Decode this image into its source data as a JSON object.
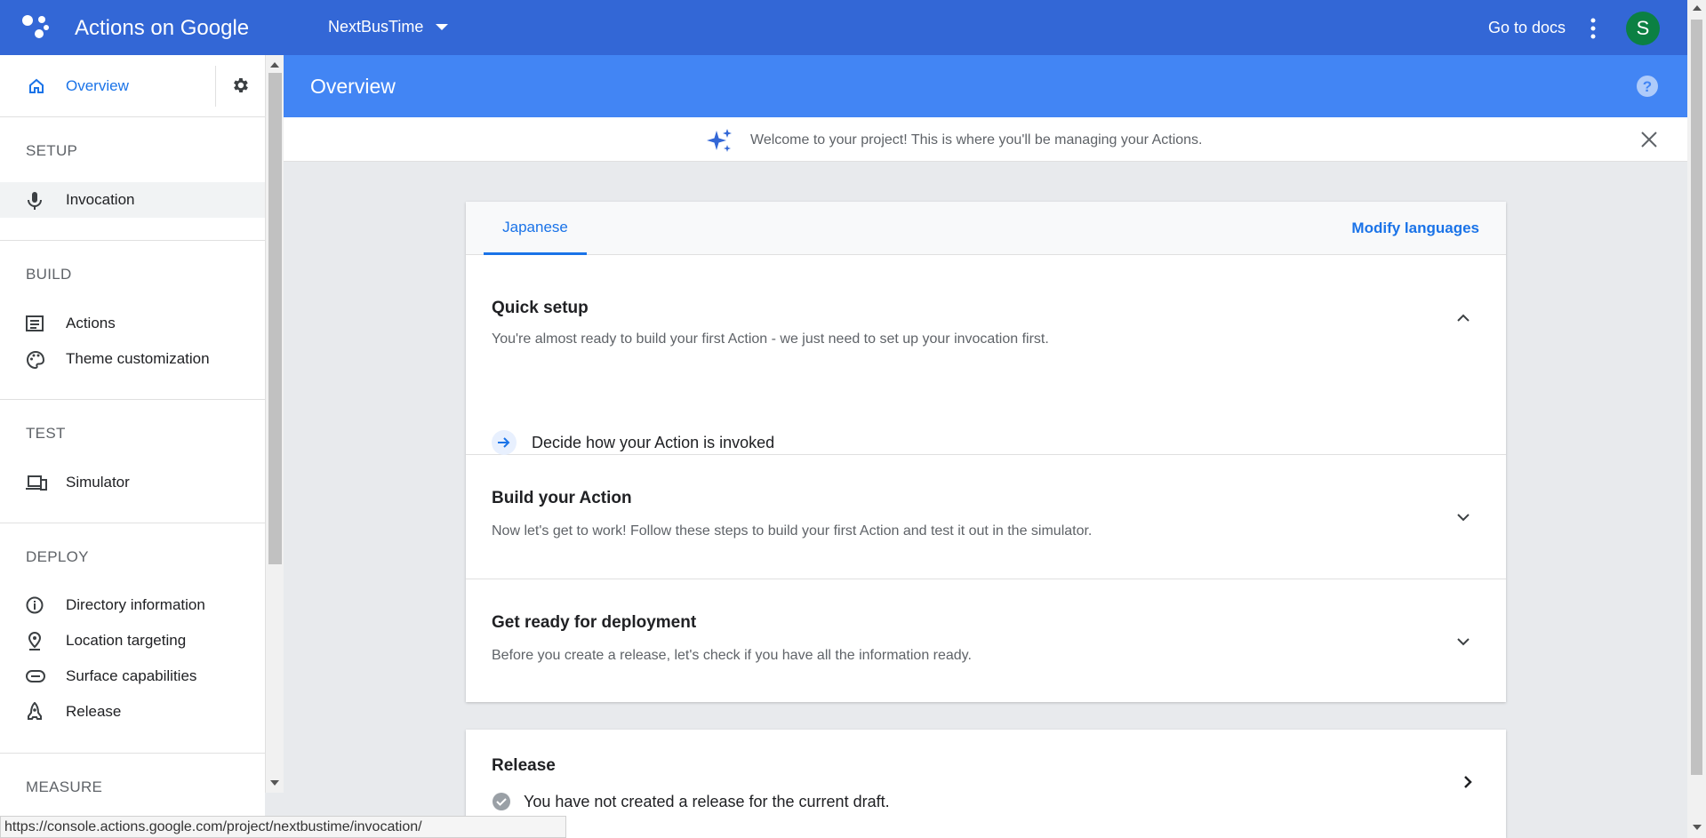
{
  "topbar": {
    "app_title": "Actions on Google",
    "project_name": "NextBusTime",
    "docs_label": "Go to docs",
    "avatar_initial": "S",
    "bar_color": "#3367d6",
    "avatar_color": "#0b8043"
  },
  "sidebar": {
    "overview_label": "Overview",
    "sections": {
      "setup": "SETUP",
      "build": "BUILD",
      "test": "TEST",
      "deploy": "DEPLOY",
      "measure": "MEASURE"
    },
    "items": {
      "invocation": "Invocation",
      "actions": "Actions",
      "theme": "Theme customization",
      "simulator": "Simulator",
      "directory": "Directory information",
      "location": "Location targeting",
      "surface": "Surface capabilities",
      "release": "Release"
    },
    "icons": [
      "home-icon",
      "gear-icon",
      "mic-icon",
      "list-icon",
      "palette-icon",
      "devices-icon",
      "info-icon",
      "location-pin-icon",
      "surface-icon",
      "rocket-icon"
    ]
  },
  "main": {
    "page_title": "Overview",
    "welcome_text": "Welcome to your project! This is where you'll be managing your Actions.",
    "tab_label": "Japanese",
    "modify_languages": "Modify languages",
    "quick_setup": {
      "title": "Quick setup",
      "desc": "You're almost ready to build your first Action - we just need to set up your invocation first.",
      "step": "Decide how your Action is invoked"
    },
    "build": {
      "title": "Build your Action",
      "desc": "Now let's get to work! Follow these steps to build your first Action and test it out in the simulator."
    },
    "deploy": {
      "title": "Get ready for deployment",
      "desc": "Before you create a release, let's check if you have all the information ready."
    },
    "release": {
      "title": "Release",
      "status": "You have not created a release for the current draft."
    },
    "accent_color": "#1a73e8",
    "band_color": "#4285f4"
  },
  "status_bar": {
    "url": "https://console.actions.google.com/project/nextbustime/invocation/"
  }
}
